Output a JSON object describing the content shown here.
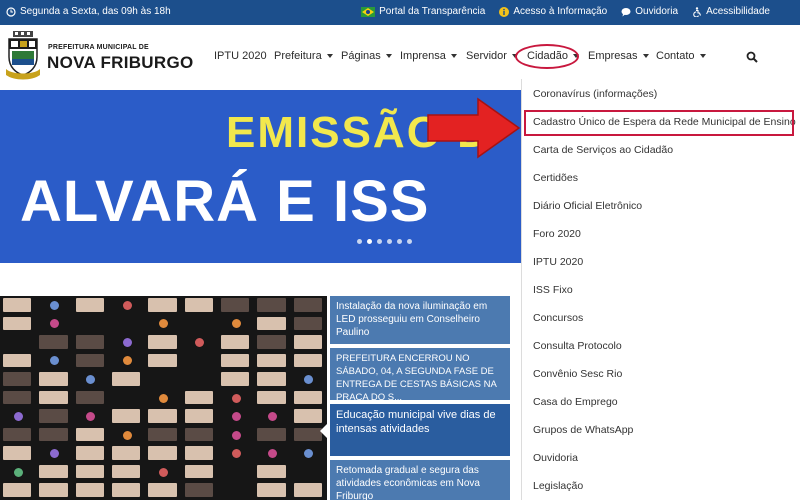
{
  "topbar": {
    "hours": "Segunda a Sexta, das 09h às 18h",
    "links": [
      "Portal da Transparência",
      "Acesso à Informação",
      "Ouvidoria",
      "Acessibilidade"
    ]
  },
  "header": {
    "brand_small": "PREFEITURA MUNICIPAL DE",
    "brand_big": "NOVA FRIBURGO"
  },
  "nav": {
    "items": [
      "IPTU 2020",
      "Prefeitura",
      "Páginas",
      "Imprensa",
      "Servidor",
      "Cidadão",
      "Empresas",
      "Contato"
    ]
  },
  "hero": {
    "line1": "EMISSÃO D",
    "line2": "ALVARÁ E ISS",
    "dots_total": 6,
    "dots_active_index": 1
  },
  "news": [
    "Instalação da nova iluminação em LED prosseguiu em Conselheiro Paulino",
    "PREFEITURA ENCERROU NO SÁBADO, 04, A SEGUNDA FASE DE ENTREGA DE CESTAS BÁSICAS NA PRAÇA DO S...",
    "Educação municipal vive dias de intensas atividades",
    "Retomada gradual e segura das atividades econômicas em Nova Friburgo"
  ],
  "dropdown": {
    "items": [
      "Coronavírus (informações)",
      "Cadastro Único de Espera da Rede Municipal de Ensino",
      "Carta de Serviços ao Cidadão",
      "Certidões",
      "Diário Oficial Eletrônico",
      "Foro 2020",
      "IPTU 2020",
      "ISS Fixo",
      "Concursos",
      "Consulta Protocolo",
      "Convênio Sesc Rio",
      "Casa do Emprego",
      "Grupos de WhatsApp",
      "Ouvidoria",
      "Legislação"
    ]
  },
  "colors": {
    "topbar": "#1c4f8c",
    "hero_bg": "#2b5cc8",
    "hero_yellow": "#f2e84d",
    "highlight_red": "#c8183e",
    "news_blue": "#4c7ab0",
    "news_active": "#2a5d9f"
  }
}
